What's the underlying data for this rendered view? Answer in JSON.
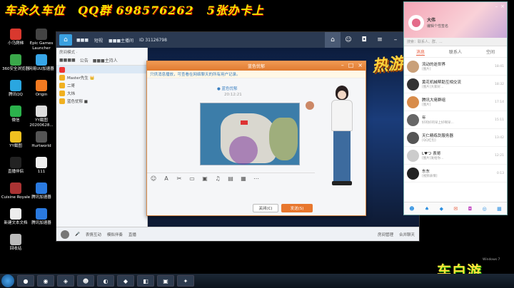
{
  "banner": {
    "text1": "车永久车位",
    "text2": "QQ群 698576262",
    "text3": "5张办卡上"
  },
  "desktop_icons": [
    {
      "label": "小乌爬梯",
      "color": "#d9382e"
    },
    {
      "label": "Epic Games Launcher",
      "color": "#444"
    },
    {
      "label": "360安全浏览器",
      "color": "#3aa84a"
    },
    {
      "label": "网易UU加速器",
      "color": "#37a6e8"
    },
    {
      "label": "腾讯QQ",
      "color": "#2aa6e0"
    },
    {
      "label": "Origin",
      "color": "#f47a20"
    },
    {
      "label": "微信",
      "color": "#2bb24c"
    },
    {
      "label": "YY截图 20200628...",
      "color": "#ddd"
    },
    {
      "label": "YY截图",
      "color": "#f0c020"
    },
    {
      "label": "Hurtworld",
      "color": "#555"
    },
    {
      "label": "直播伴侣",
      "color": "#222"
    },
    {
      "label": "111",
      "color": "#eee"
    },
    {
      "label": "Cuisine Royale",
      "color": "#a33"
    },
    {
      "label": "腾讯加速器",
      "color": "#2a7ae0"
    },
    {
      "label": "新建文本文档",
      "color": "#eee"
    },
    {
      "label": "腾讯加速器",
      "color": "#2a7ae0"
    },
    {
      "label": "回收站",
      "color": "#bbb"
    }
  ],
  "main_window": {
    "title_items": [
      "■■■",
      "短视",
      "■■■主播间",
      "ID 31126798"
    ],
    "left_tabs": [
      "■■■■",
      "公告",
      "■■■主持人"
    ],
    "left_rows": [
      "Master先生 👑",
      "二哥",
      "大炜",
      "蓝色忧郁 ■"
    ],
    "left_header": "房间模式 ·",
    "bottom_labels": [
      "表情互动",
      "模拟伴奏",
      "直播",
      "房间管理",
      "合并聊天"
    ]
  },
  "chat_window": {
    "title": "蓝色忧郁",
    "notice": "只供消息播放，可查看在网络聊天的所有用户记录。",
    "link_text": "● 蓝色忧郁",
    "time": "20:12:21",
    "close_label": "关闭(C)",
    "send_label": "发送(S)"
  },
  "qq_panel": {
    "nickname": "大伟",
    "signature": "编辑个性签名",
    "search_placeholder": "搜索：联系人、群、...",
    "tabs": [
      "消息",
      "联系人",
      "空间"
    ],
    "items": [
      {
        "name": "流动的逝世界",
        "msg": "[图片]",
        "time": "18:41",
        "color": "#c9a079"
      },
      {
        "name": "黄花机械帮助互相交流",
        "msg": "[图片]大家好...",
        "time": "18:32",
        "color": "#333"
      },
      {
        "name": "腾讯大佬群组",
        "msg": "[图片]",
        "time": "17:14",
        "color": "#d88c4a"
      },
      {
        "name": "年",
        "msg": "好的好的早上好啊早...",
        "time": "15:11",
        "color": "#666"
      },
      {
        "name": "天仁精练剑服务器",
        "msg": "[QQ红包]",
        "time": "13:42",
        "color": "#555"
      },
      {
        "name": "L♥つ 表哥",
        "msg": "[图片]发给你...",
        "time": "12:21",
        "color": "#ccc"
      },
      {
        "name": "东东",
        "msg": "[视频表情]",
        "time": "0:13",
        "color": "#222"
      }
    ]
  },
  "watermark": "车白游",
  "win_label": "Windows 7"
}
